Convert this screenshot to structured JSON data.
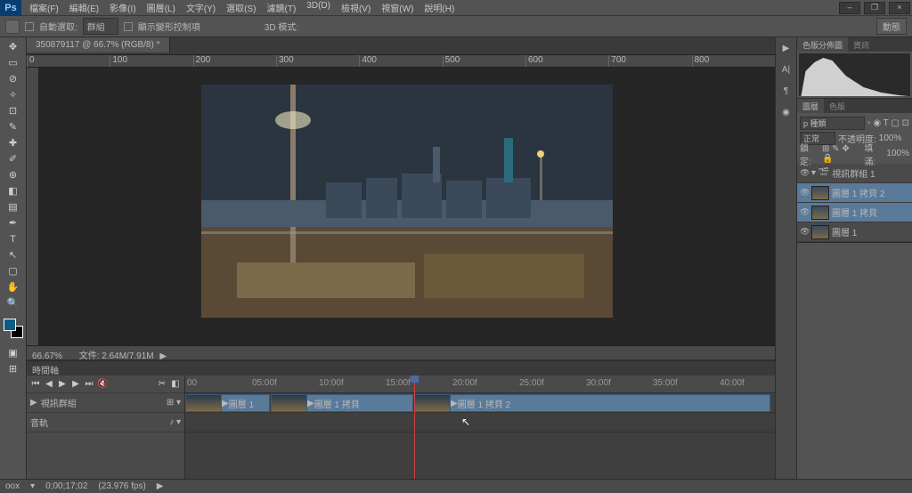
{
  "app": {
    "logo": "Ps"
  },
  "menu": [
    "檔案(F)",
    "編輯(E)",
    "影像(I)",
    "圖層(L)",
    "文字(Y)",
    "選取(S)",
    "濾鏡(T)",
    "3D(D)",
    "檢視(V)",
    "視窗(W)",
    "說明(H)"
  ],
  "options": {
    "auto_select": "自動選取:",
    "group": "群組",
    "show_transform": "顯示變形控制項",
    "mode_3d": "3D 模式:",
    "right_btn": "動態"
  },
  "doc": {
    "tab": "350879117 @ 66.7% (RGB/8) *",
    "zoom": "66.67%",
    "file_info": "文件: 2.64M/7.91M"
  },
  "timeline": {
    "tab": "時間軸",
    "marks": [
      "00",
      "05:00f",
      "10:00f",
      "15:00f",
      "20:00f",
      "25:00f",
      "30:00f",
      "35:00f",
      "40:00f"
    ],
    "track_video": "視訊群組",
    "track_audio": "音軌",
    "clips": [
      {
        "label": "圖層 1"
      },
      {
        "label": "圖層 1 拷貝"
      },
      {
        "label": "圖層 1 拷貝 2"
      }
    ]
  },
  "panels": {
    "histogram": {
      "tabs": [
        "色版分佈圖",
        "資訊"
      ]
    },
    "layers": {
      "tabs": [
        "圖層",
        "色版"
      ],
      "kind": "p 種類",
      "blend": "正常",
      "opacity_label": "不透明度:",
      "opacity": "100%",
      "lock": "鎖定:",
      "fill_label": "填滿:",
      "fill": "100%",
      "group": "視訊群組 1",
      "items": [
        "圖層 1 拷貝 2",
        "圖層 1 拷貝",
        "圖層 1"
      ]
    }
  },
  "status": {
    "left": "oox",
    "time": "0;00;17;02",
    "fps": "(23.976 fps)"
  }
}
